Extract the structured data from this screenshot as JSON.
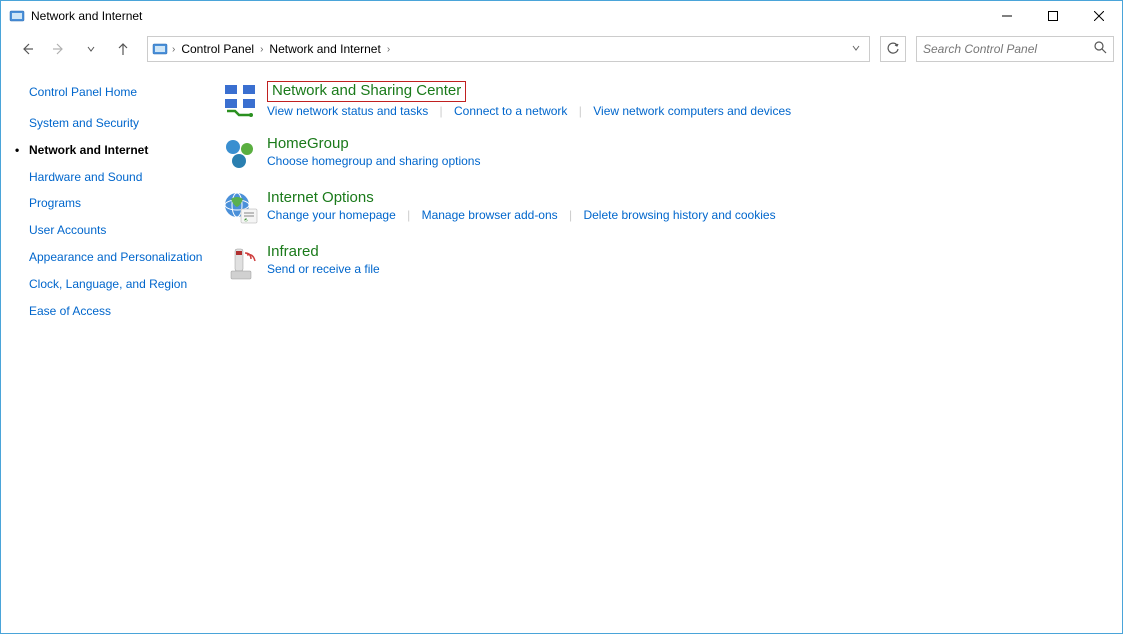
{
  "window": {
    "title": "Network and Internet"
  },
  "breadcrumb": {
    "items": [
      "Control Panel",
      "Network and Internet"
    ]
  },
  "search": {
    "placeholder": "Search Control Panel"
  },
  "sidebar": {
    "home": "Control Panel Home",
    "items": [
      {
        "label": "System and Security",
        "active": false
      },
      {
        "label": "Network and Internet",
        "active": true
      },
      {
        "label": "Hardware and Sound",
        "active": false
      },
      {
        "label": "Programs",
        "active": false
      },
      {
        "label": "User Accounts",
        "active": false
      },
      {
        "label": "Appearance and Personalization",
        "active": false
      },
      {
        "label": "Clock, Language, and Region",
        "active": false
      },
      {
        "label": "Ease of Access",
        "active": false
      }
    ]
  },
  "categories": [
    {
      "title": "Network and Sharing Center",
      "highlighted": true,
      "links": [
        "View network status and tasks",
        "Connect to a network",
        "View network computers and devices"
      ]
    },
    {
      "title": "HomeGroup",
      "highlighted": false,
      "links": [
        "Choose homegroup and sharing options"
      ]
    },
    {
      "title": "Internet Options",
      "highlighted": false,
      "links": [
        "Change your homepage",
        "Manage browser add-ons",
        "Delete browsing history and cookies"
      ]
    },
    {
      "title": "Infrared",
      "highlighted": false,
      "links": [
        "Send or receive a file"
      ]
    }
  ]
}
